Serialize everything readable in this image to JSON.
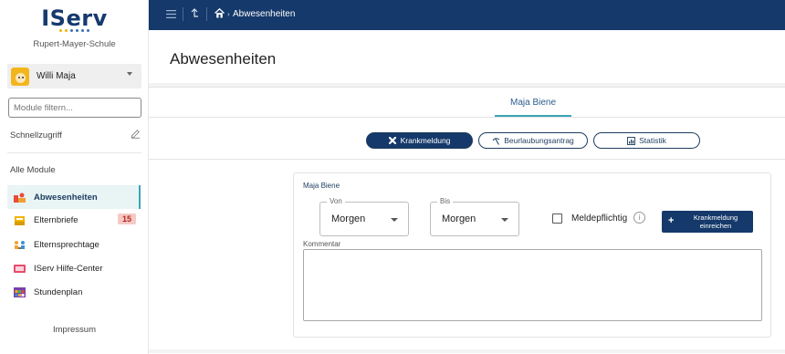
{
  "sidebar": {
    "logo": "IServ",
    "school": "Rupert-Mayer-Schule",
    "user_name": "Willi Maja",
    "filter_placeholder": "Module filtern...",
    "schnellzugriff": "Schnellzugriff",
    "alle_module": "Alle Module",
    "items": [
      {
        "label": "Abwesenheiten",
        "icon": "absence-icon"
      },
      {
        "label": "Elternbriefe",
        "icon": "letter-icon",
        "badge": "15"
      },
      {
        "label": "Elternsprechtage",
        "icon": "meeting-icon"
      },
      {
        "label": "IServ Hilfe-Center",
        "icon": "help-center-icon"
      },
      {
        "label": "Stundenplan",
        "icon": "calendar-icon"
      }
    ],
    "impressum": "Impressum"
  },
  "topbar": {
    "breadcrumb": "Abwesenheiten"
  },
  "page": {
    "title": "Abwesenheiten",
    "tab": "Maja Biene"
  },
  "actions": {
    "krankmeldung": "Krankmeldung",
    "beurlaubung": "Beurlaubungsantrag",
    "statistik": "Statistik"
  },
  "form": {
    "student": "Maja Biene",
    "von_label": "Von",
    "von_value": "Morgen",
    "bis_label": "Bis",
    "bis_value": "Morgen",
    "meldepflichtig": "Meldepflichtig",
    "info": "i",
    "submit_line1": "Krankmeldung",
    "submit_line2": "einreichen",
    "plus": "+",
    "kommentar_label": "Kommentar"
  }
}
